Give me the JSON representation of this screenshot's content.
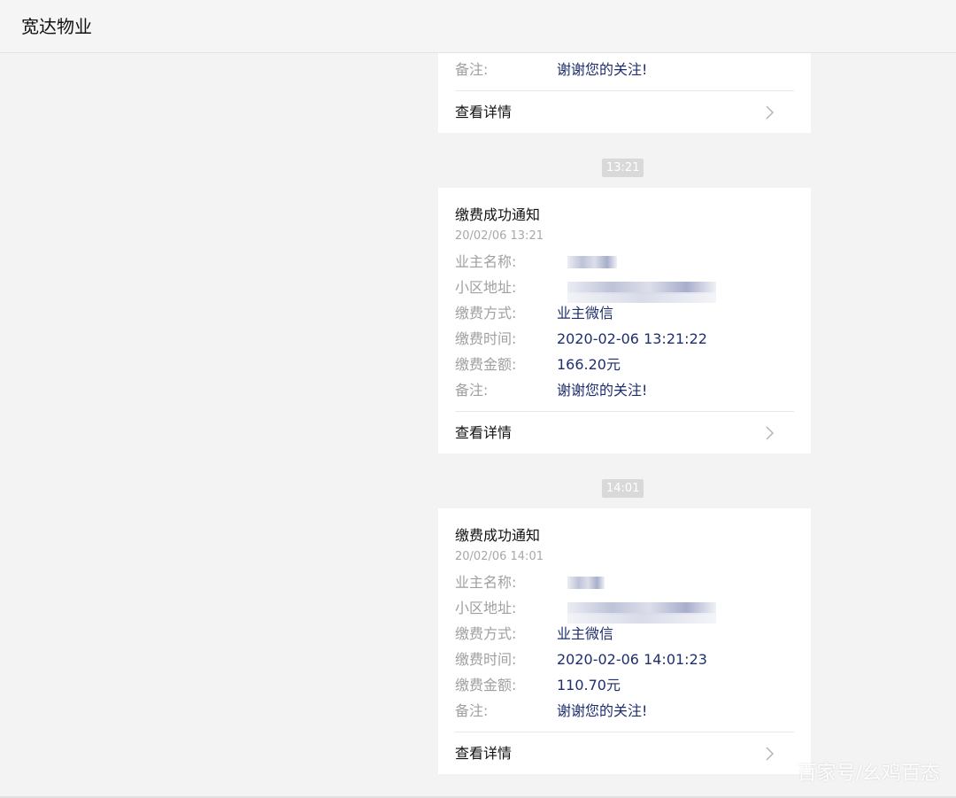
{
  "header": {
    "title": "宽达物业"
  },
  "top_card_partial": {
    "note_label": "备注:",
    "note_value": "谢谢您的关注!",
    "details_label": "查看详情"
  },
  "messages": [
    {
      "time_badge": "13:21",
      "title": "缴费成功通知",
      "date": "20/02/06 13:21",
      "owner_label": "业主名称:",
      "address_label": "小区地址:",
      "method_label": "缴费方式:",
      "method_value": "业主微信",
      "time_label": "缴费时间:",
      "time_value": "2020-02-06 13:21:22",
      "amount_label": "缴费金额:",
      "amount_value": "166.20元",
      "note_label": "备注:",
      "note_value": "谢谢您的关注!",
      "details_label": "查看详情"
    },
    {
      "time_badge": "14:01",
      "title": "缴费成功通知",
      "date": "20/02/06 14:01",
      "owner_label": "业主名称:",
      "address_label": "小区地址:",
      "method_label": "缴费方式:",
      "method_value": "业主微信",
      "time_label": "缴费时间:",
      "time_value": "2020-02-06 14:01:23",
      "amount_label": "缴费金额:",
      "amount_value": "110.70元",
      "note_label": "备注:",
      "note_value": "谢谢您的关注!",
      "details_label": "查看详情"
    }
  ],
  "watermark": "百家号/幺鸡百态",
  "icons": {
    "chevron": "chevron-right-icon"
  }
}
